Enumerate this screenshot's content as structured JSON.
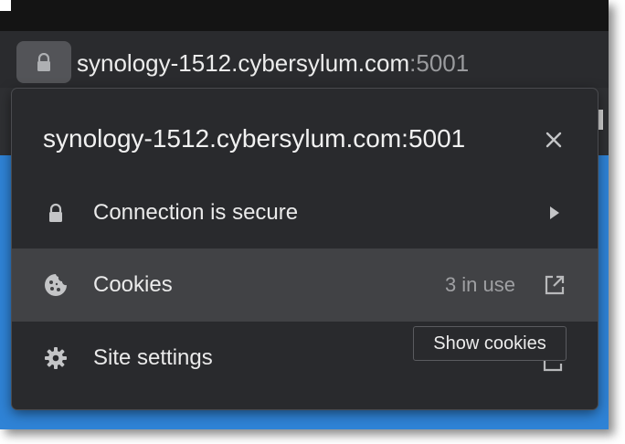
{
  "address_bar": {
    "host": "synology-1512.cybersylum.com",
    "port": ":5001",
    "lock_icon": "lock-icon"
  },
  "site_info_popup": {
    "title": "synology-1512.cybersylum.com:5001",
    "close_icon": "close-icon",
    "rows": [
      {
        "icon": "lock-icon",
        "label": "Connection is secure",
        "trailing": "chevron-right-icon"
      },
      {
        "icon": "cookie-icon",
        "label": "Cookies",
        "detail": "3 in use",
        "trailing": "external-link-icon"
      },
      {
        "icon": "gear-icon",
        "label": "Site settings",
        "trailing": "external-link-icon"
      }
    ]
  },
  "tooltip": {
    "text": "Show cookies"
  },
  "colors": {
    "popup_bg": "#292a2d",
    "row_highlight": "#414245",
    "page_blue": "#2f83d6",
    "text_primary": "#eaeaea",
    "text_secondary": "#9fa0a3"
  }
}
